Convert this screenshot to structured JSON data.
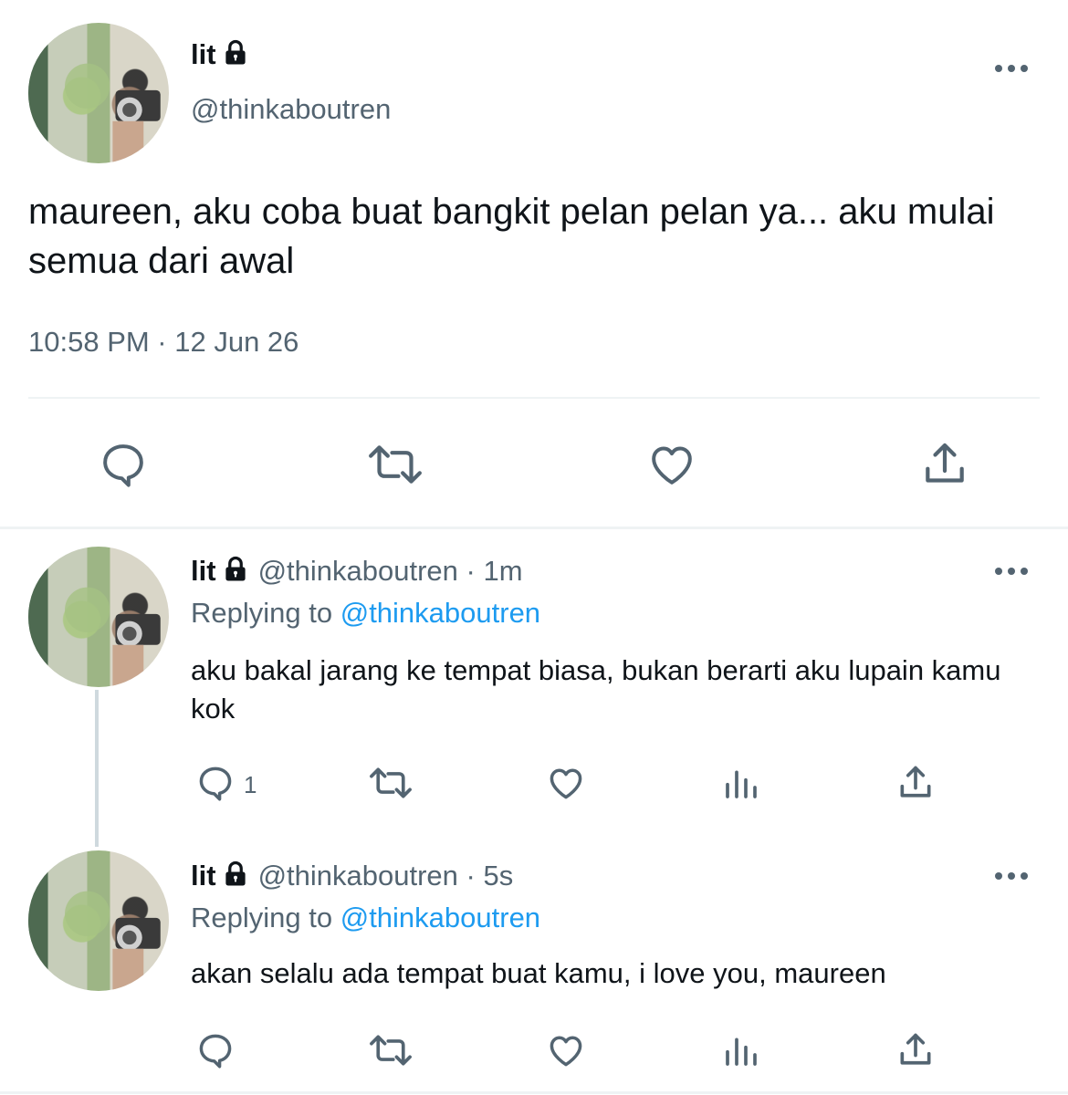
{
  "main_tweet": {
    "name": "lit",
    "handle": "@thinkaboutren",
    "text": "maureen, aku coba buat bangkit pelan pelan ya... aku mulai semua dari awal",
    "timestamp": "10:58 PM · 12 Jun 26",
    "actions": [
      "reply-icon",
      "retweet-icon",
      "like-icon",
      "share-icon"
    ]
  },
  "replies": [
    {
      "name": "lit",
      "handle": "@thinkaboutren",
      "time": "· 1m",
      "replying_prefix": "Replying to",
      "replying_to": "@thinkaboutren",
      "text": "aku bakal jarang ke tempat biasa, bukan berarti aku lupain kamu kok",
      "reply_count": "1"
    },
    {
      "name": "lit",
      "handle": "@thinkaboutren",
      "time": "· 5s",
      "replying_prefix": "Replying to",
      "replying_to": "@thinkaboutren",
      "text": "akan selalu ada tempat buat kamu, i love you, maureen",
      "reply_count": ""
    }
  ],
  "colors": {
    "text": "#0f1419",
    "secondary": "#536471",
    "link": "#1d9bf0",
    "divider": "#eff3f4"
  }
}
